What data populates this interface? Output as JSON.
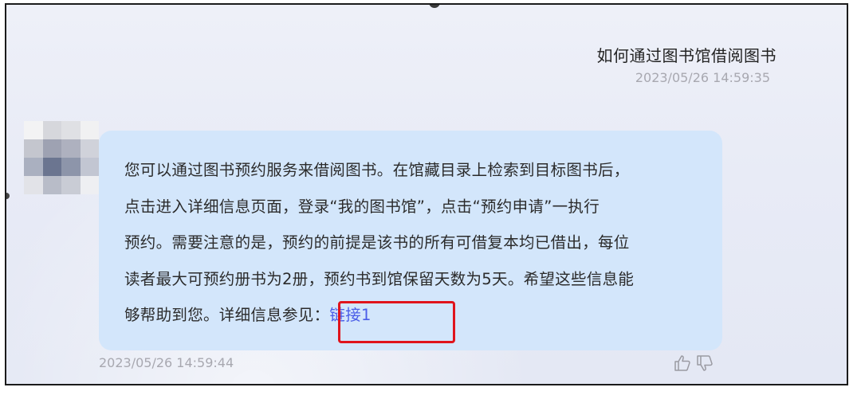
{
  "user_message": {
    "text": "如何通过图书馆借阅图书",
    "timestamp": "2023/05/26 14:59:35"
  },
  "bot_message": {
    "lines": [
      "您可以通过图书预约服务来借阅图书。在馆藏目录上检索到目标图书后，",
      "点击进入详细信息页面，登录“我的图书馆”，点击“预约申请”一执行",
      "预约。需要注意的是，预约的前提是该书的所有可借复本均已借出，每位",
      "读者最大可预约册书为2册，预约书到馆保留天数为5天。希望这些信息能"
    ],
    "last_line_prefix": "够帮助到您。详细信息参见：",
    "link_text": "链接1",
    "timestamp": "2023/05/26 14:59:44"
  },
  "actions": {
    "like_icon": "thumbs-up-icon",
    "dislike_icon": "thumbs-down-icon"
  },
  "colors": {
    "bubble_bg": "#d3e6fb",
    "link": "#4a5de8",
    "highlight": "#e0141c",
    "timestamp": "#a8a8b0"
  }
}
